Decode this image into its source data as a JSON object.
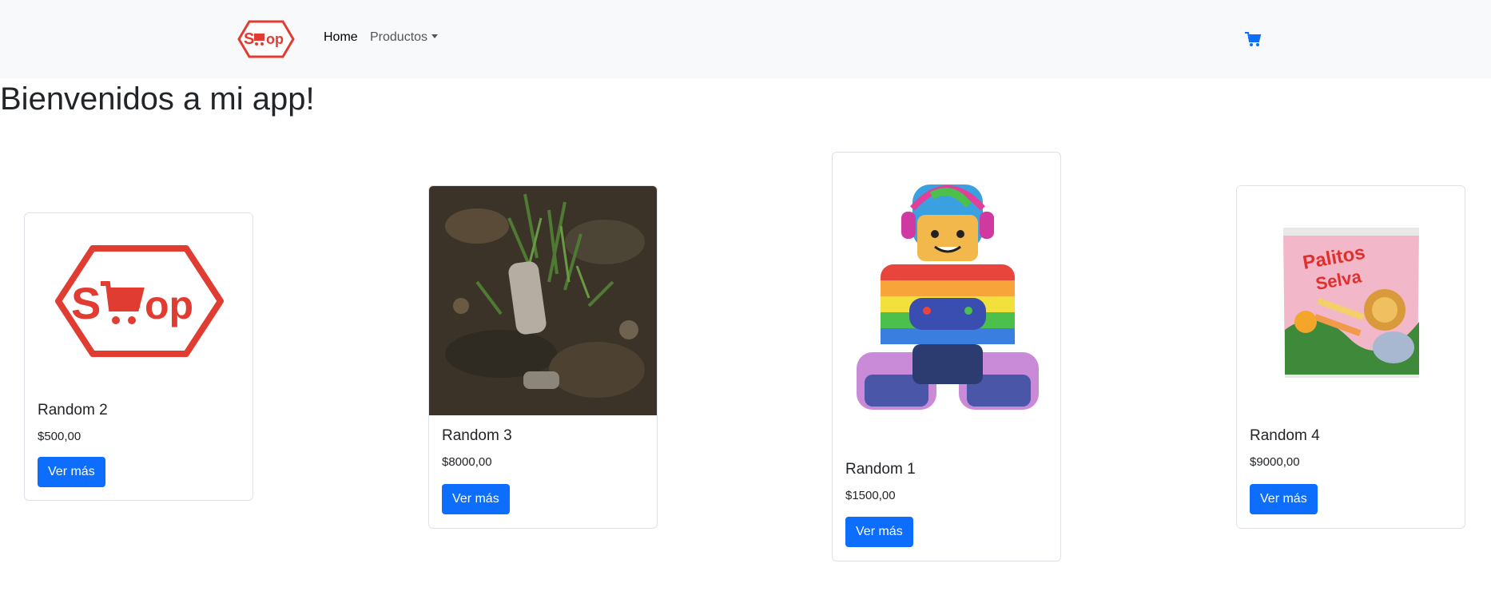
{
  "nav": {
    "brand_text": "Shop",
    "home_label": "Home",
    "products_label": "Productos",
    "cart_icon": "shopping-cart-icon",
    "accent_color": "#0d6efd",
    "brand_color": "#e03c31"
  },
  "page": {
    "title": "Bienvenidos a mi app!"
  },
  "products": {
    "random2": {
      "title": "Random 2",
      "price": "$500,00",
      "button": "Ver más",
      "image": "shop-logo"
    },
    "random3": {
      "title": "Random 3",
      "price": "$8000,00",
      "button": "Ver más",
      "image": "ground-photo"
    },
    "random1": {
      "title": "Random 1",
      "price": "$1500,00",
      "button": "Ver más",
      "image": "gamer-character"
    },
    "random4": {
      "title": "Random 4",
      "price": "$9000,00",
      "button": "Ver más",
      "image": "candy-bag"
    }
  }
}
